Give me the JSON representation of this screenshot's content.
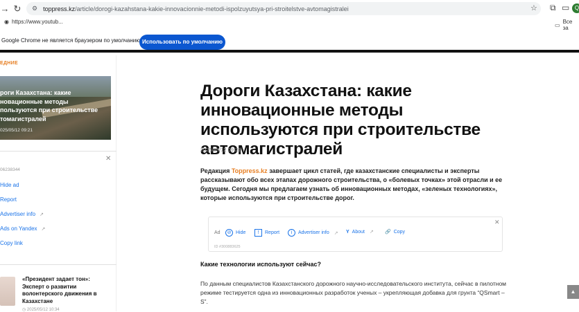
{
  "browser": {
    "url_host": "toppress.kz",
    "url_path": "/article/dorogi-kazahstana-kakie-innovacionnie-metodi-ispolzuyutsya-pri-stroitelstve-avtomagistralei",
    "bookmark_left": "https://www.youtub...",
    "bookmark_right": "Все за",
    "profile_initial": "Q",
    "infobar_message": "Google Chrome не является браузером по умолчанию.",
    "infobar_button": "Использовать по умолчанию"
  },
  "sidebar": {
    "tag": "ЕДНИЕ",
    "card": {
      "title": "роги Казахстана: какие новационные методы пользуются при строительстве томагистралей",
      "date": "025/05/12 09:21"
    },
    "ad": {
      "id": "06238344",
      "links": [
        "Hide ad",
        "Report",
        "Advertiser info",
        "Ads on Yandex",
        "Copy link"
      ]
    },
    "news": {
      "title": "«Президент задает тон»: Эксперт о развитии волонтерского движения в Казахстане",
      "date": "2025/05/12 10:34"
    }
  },
  "article": {
    "title": "Дороги Казахстана: какие инновационные методы используются при строительстве автомагистралей",
    "date": "2025/05/12 09:21",
    "lead_prefix": "Редакция ",
    "lead_brand": "Toppress.kz",
    "lead_rest": " завершает цикл статей, где казахстанские специалисты и эксперты рассказывают обо всех этапах дорожного строительства, о «болевых точках» этой отрасли и ее будущем. Сегодня мы предлагаем узнать об инновационных методах, «зеленых технологиях», которые используются при строительстве дорог.",
    "ad": {
      "label": "Ad",
      "hide": "Hide",
      "report": "Report",
      "advertiser": "Advertiser info",
      "about": "About",
      "copy": "Copy",
      "id": "ID #300883625"
    },
    "subheading": "Какие технологии используют сейчас?",
    "paragraph": "По данным специалистов Казахстанского дорожного научно-исследовательского института, сейчас в пилотном режиме тестируется одна из инновационных разработок ученых – укрепляющая добавка для грунта “QSmart – S”."
  }
}
